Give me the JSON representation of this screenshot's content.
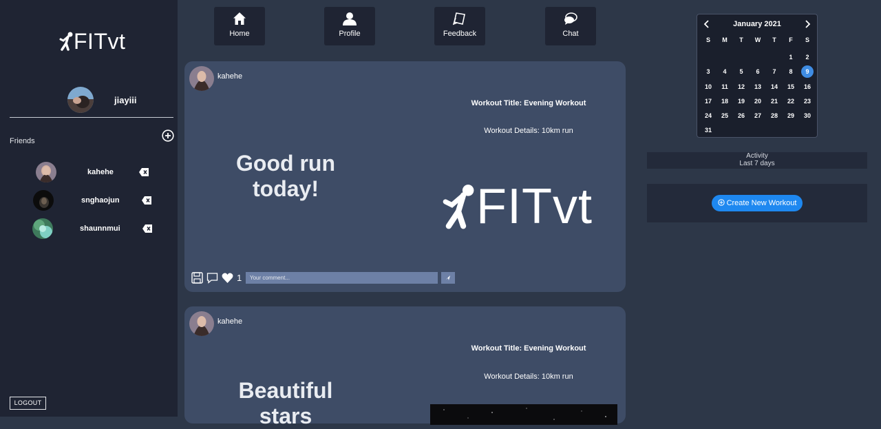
{
  "app": {
    "name": "FITvt"
  },
  "user": {
    "name": "jiayiii"
  },
  "friends_label": "Friends",
  "friends": [
    {
      "name": "kahehe"
    },
    {
      "name": "snghaojun"
    },
    {
      "name": "shaunnmui"
    }
  ],
  "logout_label": "LOGOUT",
  "nav": [
    {
      "label": "Home",
      "icon": "home-icon"
    },
    {
      "label": "Profile",
      "icon": "user-icon"
    },
    {
      "label": "Feedback",
      "icon": "feedback-icon"
    },
    {
      "label": "Chat",
      "icon": "chat-icon"
    }
  ],
  "posts": [
    {
      "user": "kahehe",
      "workout_title": "Workout Title: Evening Workout",
      "workout_details": "Workout Details: 10km run",
      "caption_line1": "Good run",
      "caption_line2": "today!",
      "image_text": "FITvt",
      "likes": "1",
      "comment_placeholder": "Your comment..."
    },
    {
      "user": "kahehe",
      "workout_title": "Workout Title: Evening Workout",
      "workout_details": "Workout Details: 10km run",
      "caption_line1": "Beautiful",
      "caption_line2": "stars"
    }
  ],
  "calendar": {
    "month": "January 2021",
    "weekdays": [
      "S",
      "M",
      "T",
      "W",
      "T",
      "F",
      "S"
    ],
    "days": [
      "",
      "",
      "",
      "",
      "",
      "1",
      "2",
      "3",
      "4",
      "5",
      "6",
      "7",
      "8",
      "9",
      "10",
      "11",
      "12",
      "13",
      "14",
      "15",
      "16",
      "17",
      "18",
      "19",
      "20",
      "21",
      "22",
      "23",
      "24",
      "25",
      "26",
      "27",
      "28",
      "29",
      "30",
      "31"
    ],
    "selected": "9"
  },
  "activity": {
    "title": "Activity",
    "subtitle": "Last 7 days"
  },
  "create_workout_label": "Create New Workout",
  "colors": {
    "accent": "#1e88f0",
    "selected_day": "#3f8ce3",
    "sidebar": "#1f2433",
    "post_card": "#3e4c66"
  }
}
